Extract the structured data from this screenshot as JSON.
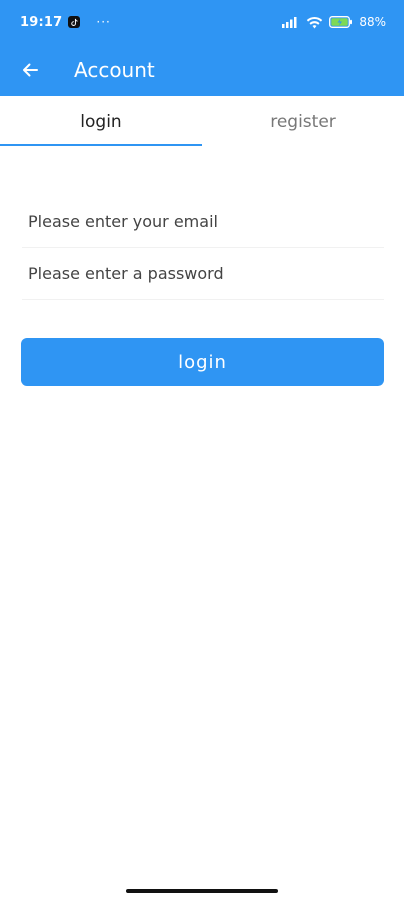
{
  "status_bar": {
    "time": "19:17",
    "more": "···",
    "battery": "88%",
    "notification_icon": "tiktok-icon",
    "icons": [
      "signal-icon",
      "wifi-icon",
      "battery-icon"
    ]
  },
  "app_bar": {
    "title": "Account",
    "back_icon": "arrow-left-icon"
  },
  "tabs": [
    {
      "label": "login",
      "active": true
    },
    {
      "label": "register",
      "active": false
    }
  ],
  "form": {
    "email_placeholder": "Please enter your email",
    "password_placeholder": "Please enter a password",
    "submit_label": "login"
  },
  "colors": {
    "primary": "#2f95f3",
    "background": "#ffffff",
    "text_dark": "#222222",
    "text_muted": "#777777"
  }
}
